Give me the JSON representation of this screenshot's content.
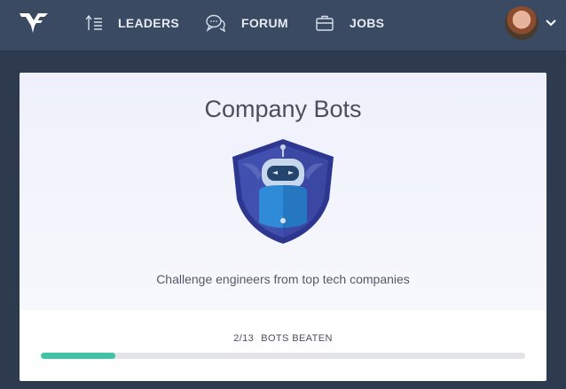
{
  "nav": {
    "leaders_label": "LEADERS",
    "forum_label": "FORUM",
    "jobs_label": "JOBS"
  },
  "card": {
    "title": "Company Bots",
    "subtitle": "Challenge engineers from top tech companies",
    "progress": {
      "beaten": "2/13",
      "caption": "BOTS BEATEN",
      "fraction": 0.154
    }
  },
  "colors": {
    "topbar": "#3a4a62",
    "background": "#2e3b4e",
    "progress_fill": "#40c2a5",
    "shield": "#3f4aa8",
    "robot": "#2b7fd0"
  },
  "icons": [
    "logo-icon",
    "leaders-icon",
    "forum-icon",
    "jobs-icon",
    "chevron-down-icon",
    "bot-shield-icon"
  ]
}
